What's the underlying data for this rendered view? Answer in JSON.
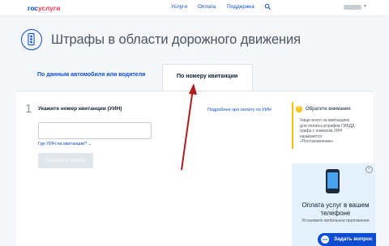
{
  "header": {
    "logo_part1": "гос",
    "logo_part2": "услуги",
    "nav": [
      "Услуги",
      "Оплата",
      "Поддержка"
    ],
    "search_icon": "search-icon"
  },
  "page": {
    "title": "Штрафы в области дорожного движения",
    "title_icon": "traffic-light-icon"
  },
  "tabs": [
    {
      "label": "По данным автомобиля или водителя",
      "active": false
    },
    {
      "label": "По номеру квитанции",
      "active": true
    }
  ],
  "form": {
    "step": "1",
    "label": "Укажите номер квитанции (УИН)",
    "help_link": "Подробнее про оплату по УИН",
    "input_value": "",
    "where_link": "Где УИН на квитанции?",
    "submit": "Перейти к оплате"
  },
  "notice": {
    "title": "Обратите внимание",
    "text": "Чаще всего на квитанциях для оплаты штрафов ГИБДД графа с номером УИН называется «Постановление»"
  },
  "promo": {
    "title": "Оплата услуг в вашем телефоне",
    "text": "Установите мобильное приложение"
  },
  "ask": {
    "label": "Задать вопрос"
  },
  "colors": {
    "accent": "#0d4cd3",
    "brand_red": "#ee3f58",
    "notice": "#ffc100",
    "arrow": "#b01c1c"
  }
}
